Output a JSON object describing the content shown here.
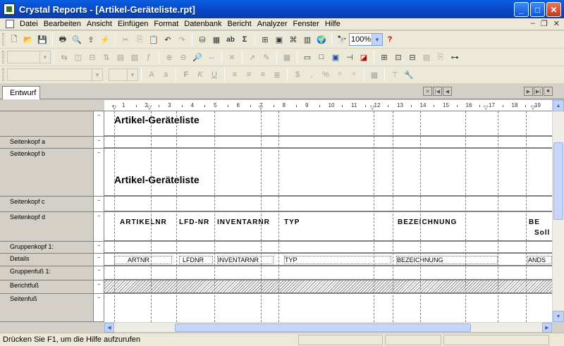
{
  "window": {
    "title": "Crystal Reports - [Artikel-Geräteliste.rpt]"
  },
  "menu": [
    "Datei",
    "Bearbeiten",
    "Ansicht",
    "Einfügen",
    "Format",
    "Datenbank",
    "Bericht",
    "Analyzer",
    "Fenster",
    "Hilfe"
  ],
  "toolbar": {
    "zoom": "100%",
    "search_icon": "binoculars-icon",
    "help_icon": "whats-this-icon"
  },
  "tabs": {
    "active": "Entwurf"
  },
  "ruler": [
    "1",
    "2",
    "3",
    "4",
    "5",
    "6",
    "7",
    "8",
    "9",
    "10",
    "11",
    "12",
    "13",
    "14",
    "15",
    "16",
    "17",
    "18",
    "19"
  ],
  "sections": [
    {
      "label": "",
      "mark": ""
    },
    {
      "label": "Seitenkopf a",
      "mark": ""
    },
    {
      "label": "Seitenkopf b",
      "mark": ""
    },
    {
      "label": "Seitenkopf c",
      "mark": ""
    },
    {
      "label": "Seitenkopf d",
      "mark": ""
    },
    {
      "label": "Gruppenkopf 1:",
      "mark": ""
    },
    {
      "label": "Details",
      "mark": ""
    },
    {
      "label": "Gruppenfuß 1:",
      "mark": ""
    },
    {
      "label": "Berichtfuß",
      "mark": ""
    },
    {
      "label": "Seitenfuß",
      "mark": ""
    }
  ],
  "report": {
    "heading_top": "Artikel-Geräteliste",
    "heading_b": "Artikel-Geräteliste",
    "headers": [
      "ARTIKELNR",
      "LFD-NR",
      "INVENTARNR",
      "TYP",
      "BEZEICHNUNG",
      "BE",
      "Soll"
    ],
    "details": [
      "ARTNR",
      "LFDNR",
      "INVENTARNR",
      "TYP",
      "BEZEICHNUNG",
      "ANDS"
    ]
  },
  "status": {
    "text": "Drücken Sie F1, um die Hilfe aufzurufen"
  }
}
